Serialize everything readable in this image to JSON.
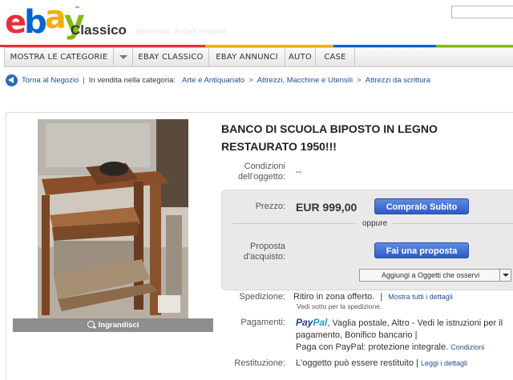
{
  "header": {
    "logo_letters": [
      "e",
      "b",
      "a",
      "y"
    ],
    "tm": "™",
    "site_name": "Classico",
    "faint_text": "Benvenuto. Accedi o iscriviti"
  },
  "nav": {
    "items": [
      "Mostra le categorie",
      "eBay Classico",
      "eBay Annunci",
      "Auto",
      "Case"
    ]
  },
  "breadcrumb": {
    "back": "Torna al Negozio",
    "sep": "|",
    "in_category": "In vendita nella categoria:",
    "path": [
      "Arte e Antiquariato",
      "Attrezzi, Macchine e Utensili",
      "Attrezzi da scrittura"
    ],
    "arrow": ">"
  },
  "image": {
    "zoom_label": "Ingrandisci"
  },
  "listing": {
    "title": "BANCO DI SCUOLA BIPOSTO IN LEGNO RESTAURATO 1950!!!",
    "condition_label": "Condizioni dell'oggetto:",
    "condition_value": "--",
    "price_label": "Prezzo:",
    "price_value": "EUR 999,00",
    "buy_button": "Compralo Subito",
    "or": "oppure",
    "offer_label": "Proposta d'acquisto:",
    "offer_button": "Fai una proposta",
    "watch_select": "Aggiungi a Oggetti che osservi",
    "shipping_label": "Spedizione:",
    "shipping_value": "Ritiro in zona offerto.",
    "shipping_link": "Mostra tutti i dettagli",
    "shipping_note": "Vedi sotto per la spedizione.",
    "payments_label": "Pagamenti:",
    "paypal_logo": [
      "Pay",
      "Pal"
    ],
    "payments_line1": ", Vaglia postale, Altro - Vedi le istruzioni per il",
    "payments_line2": "pagamento, Bonifico bancario |",
    "payments_line3": "Paga con PayPal: protezione integrale.",
    "payments_link": "Condizioni",
    "returns_label": "Restituzione:",
    "returns_value": "L'oggetto può essere restituito |",
    "returns_link": "Leggi i dettagli"
  },
  "colors": {
    "ebay_red": "#e53238",
    "ebay_blue": "#0064d2",
    "ebay_yellow": "#f5af02",
    "ebay_green": "#86b817",
    "link": "#1d4e93",
    "button": "#2d5bc4"
  }
}
